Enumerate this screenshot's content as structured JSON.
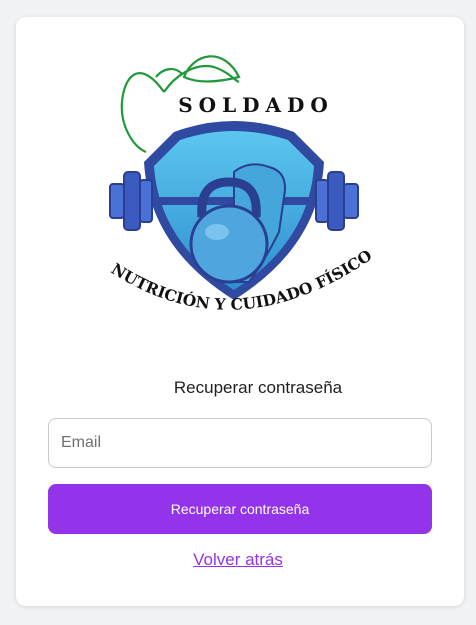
{
  "logo": {
    "brand_name": "SOLDADO",
    "tagline": "NUTRICIÓN Y CUIDADO FÍSICO"
  },
  "form": {
    "heading": "Recuperar contraseña",
    "email_placeholder": "Email",
    "email_value": "",
    "submit_label": "Recuperar contraseña",
    "back_label": "Volver atrás"
  },
  "colors": {
    "accent": "#9333ea",
    "shield_dark": "#2f4aa0",
    "shield_light": "#4fb8e8",
    "leaf": "#1f9a3a"
  }
}
